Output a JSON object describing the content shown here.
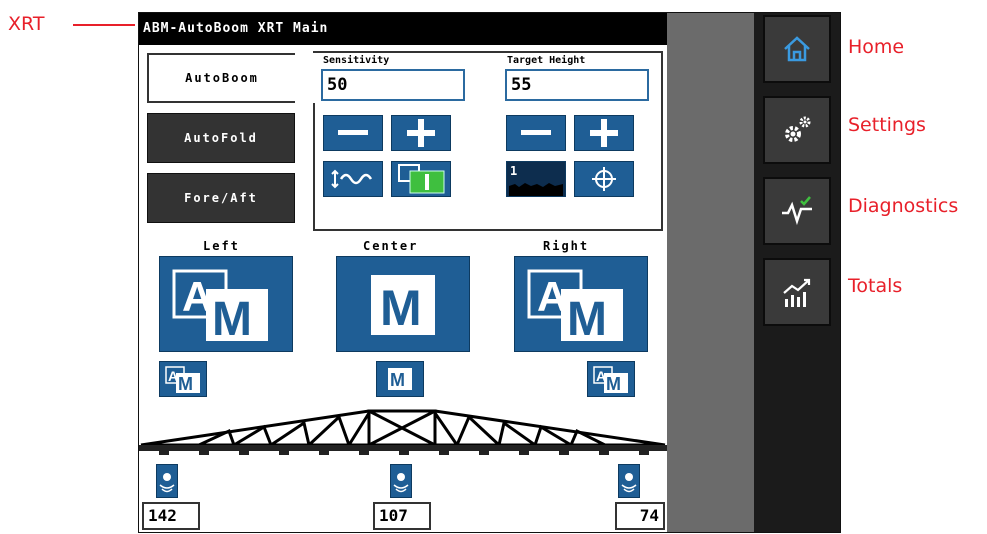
{
  "callouts": {
    "xrt": "XRT",
    "home": "Home",
    "settings": "Settings",
    "diagnostics": "Diagnostics",
    "totals": "Totals"
  },
  "colors": {
    "callout": "#e8202a",
    "button_blue": "#1f5e95",
    "titlebar": "#000000",
    "nav_panel": "#1b1b1b",
    "check_green": "#3fbf3f"
  },
  "titlebar": {
    "title": "ABM-AutoBoom XRT Main"
  },
  "tabs": [
    {
      "label": "AutoBoom",
      "active": true
    },
    {
      "label": "AutoFold",
      "active": false
    },
    {
      "label": "Fore/Aft",
      "active": false
    }
  ],
  "sensitivity": {
    "label": "Sensitivity",
    "value": "50",
    "buttons": [
      "minus-icon",
      "plus-icon",
      "terrain-wave-icon",
      "enable-toggle-icon"
    ]
  },
  "target_height": {
    "label": "Target Height",
    "value": "55",
    "buttons": [
      "minus-icon",
      "plus-icon",
      "ground-profile-icon",
      "crosshair-icon"
    ],
    "profile_marker": "1"
  },
  "sections": [
    {
      "label": "Left",
      "mode_icon": "auto-manual-icon",
      "reading": "142"
    },
    {
      "label": "Center",
      "mode_icon": "manual-icon",
      "reading": "107"
    },
    {
      "label": "Right",
      "mode_icon": "auto-manual-icon",
      "reading": "74"
    }
  ],
  "mode_letters": {
    "auto": "A",
    "manual": "M"
  },
  "nav": [
    "home-icon",
    "settings-gears-icon",
    "diagnostics-icon",
    "totals-chart-icon"
  ]
}
